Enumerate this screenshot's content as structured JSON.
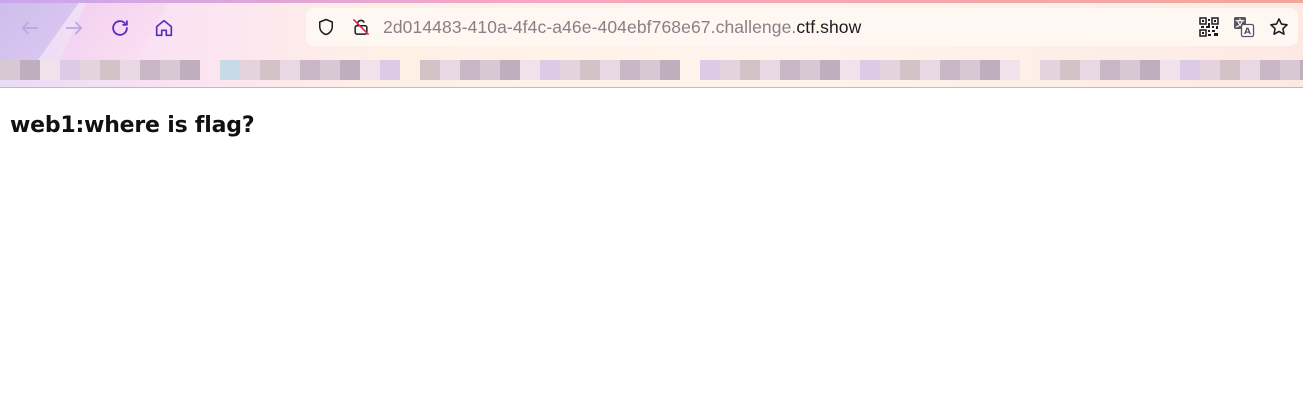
{
  "browser": {
    "url_path": "2d014483-410a-4f4c-a46e-404ebf768e67.challenge.",
    "url_domain": "ctf.show",
    "icons": {
      "back": "arrow-left-icon",
      "forward": "arrow-right-icon",
      "reload": "reload-icon",
      "home": "home-icon",
      "tracking": "shield-icon",
      "insecure": "insecure-lock-icon",
      "qr": "qr-code-icon",
      "translate": "translate-icon",
      "bookmark": "star-icon"
    },
    "colors": {
      "accent": "#5b2dbd",
      "url_text": "#8a7f86",
      "domain_text": "#1c1b22",
      "insecure": "#e0245e"
    }
  },
  "page": {
    "heading": "web1:where is flag?"
  }
}
